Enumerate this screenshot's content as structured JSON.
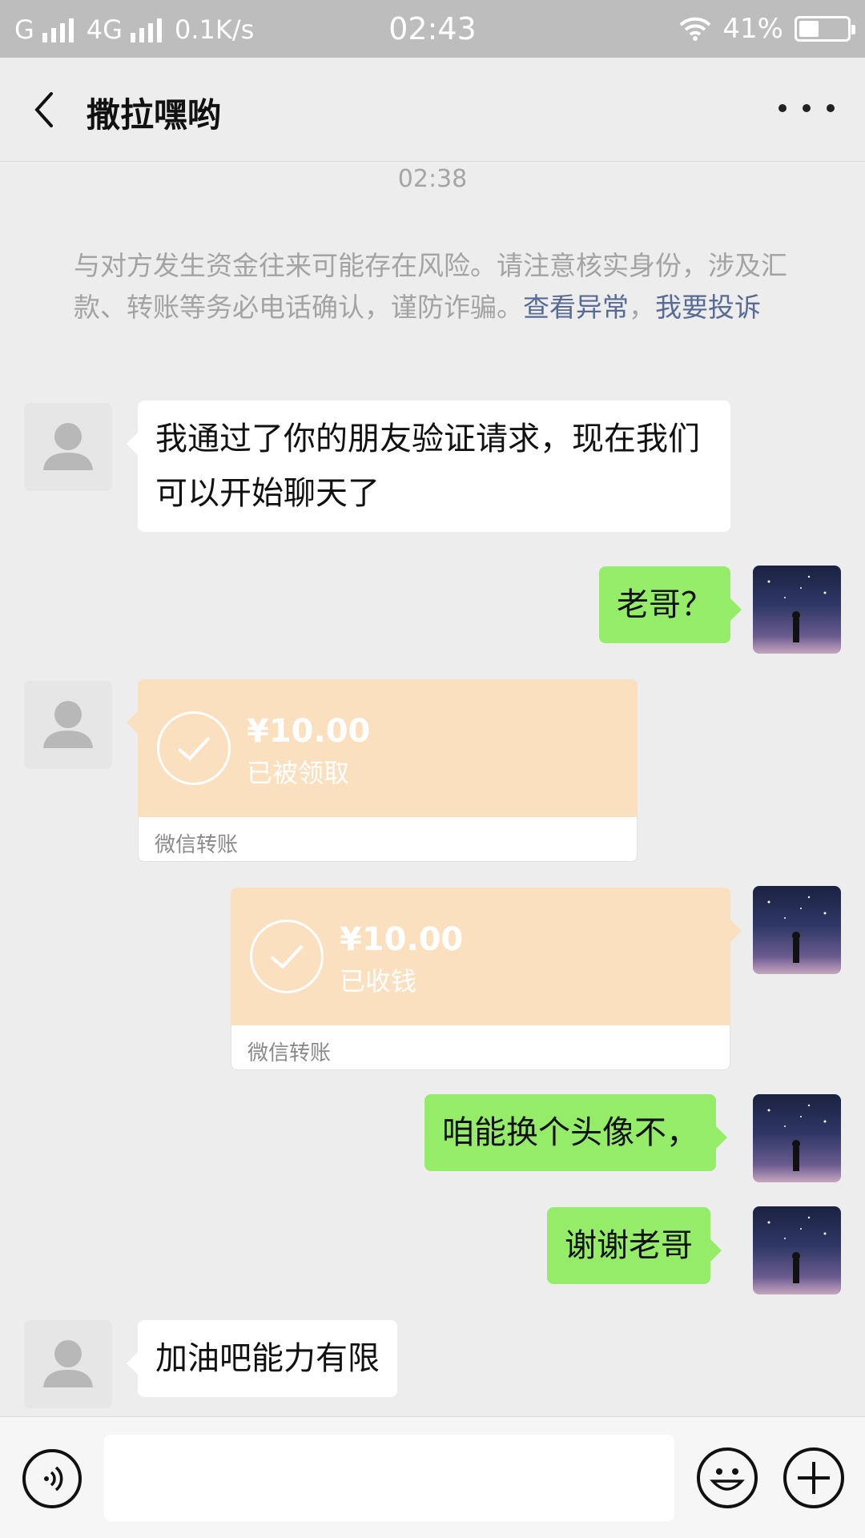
{
  "status_bar": {
    "network1": "G",
    "network2": "4G",
    "speed": "0.1K/s",
    "time": "02:43",
    "battery": "41%",
    "battery_level": 0.41
  },
  "header": {
    "title": "撒拉嘿哟",
    "back_icon": "back-chevron-icon",
    "more_icon": "more-dots-icon"
  },
  "timestamp": "02:38",
  "notice": {
    "text": "与对方发生资金往来可能存在风险。请注意核实身份，涉及汇款、转账等务必电话确认，谨防诈骗。",
    "link1": "查看异常",
    "separator": "，",
    "link2": "我要投诉"
  },
  "messages": [
    {
      "side": "in",
      "type": "text",
      "text": "我通过了你的朋友验证请求，现在我们可以开始聊天了"
    },
    {
      "side": "out",
      "type": "text",
      "text": "老哥？"
    },
    {
      "side": "in",
      "type": "transfer",
      "amount": "¥10.00",
      "status": "已被领取",
      "footer": "微信转账"
    },
    {
      "side": "out",
      "type": "transfer",
      "amount": "¥10.00",
      "status": "已收钱",
      "footer": "微信转账"
    },
    {
      "side": "out",
      "type": "text",
      "text": "咱能换个头像不，"
    },
    {
      "side": "out",
      "type": "text",
      "text": "谢谢老哥"
    },
    {
      "side": "in",
      "type": "text",
      "text": "加油吧能力有限"
    }
  ],
  "input_bar": {
    "voice_icon": "voice-icon",
    "emoji_icon": "emoji-icon",
    "plus_icon": "plus-icon",
    "text_value": ""
  },
  "colors": {
    "background": "#ededed",
    "incoming_bubble": "#ffffff",
    "outgoing_bubble": "#95ec69",
    "transfer_card": "#fbe0bf",
    "link": "#576b95"
  }
}
